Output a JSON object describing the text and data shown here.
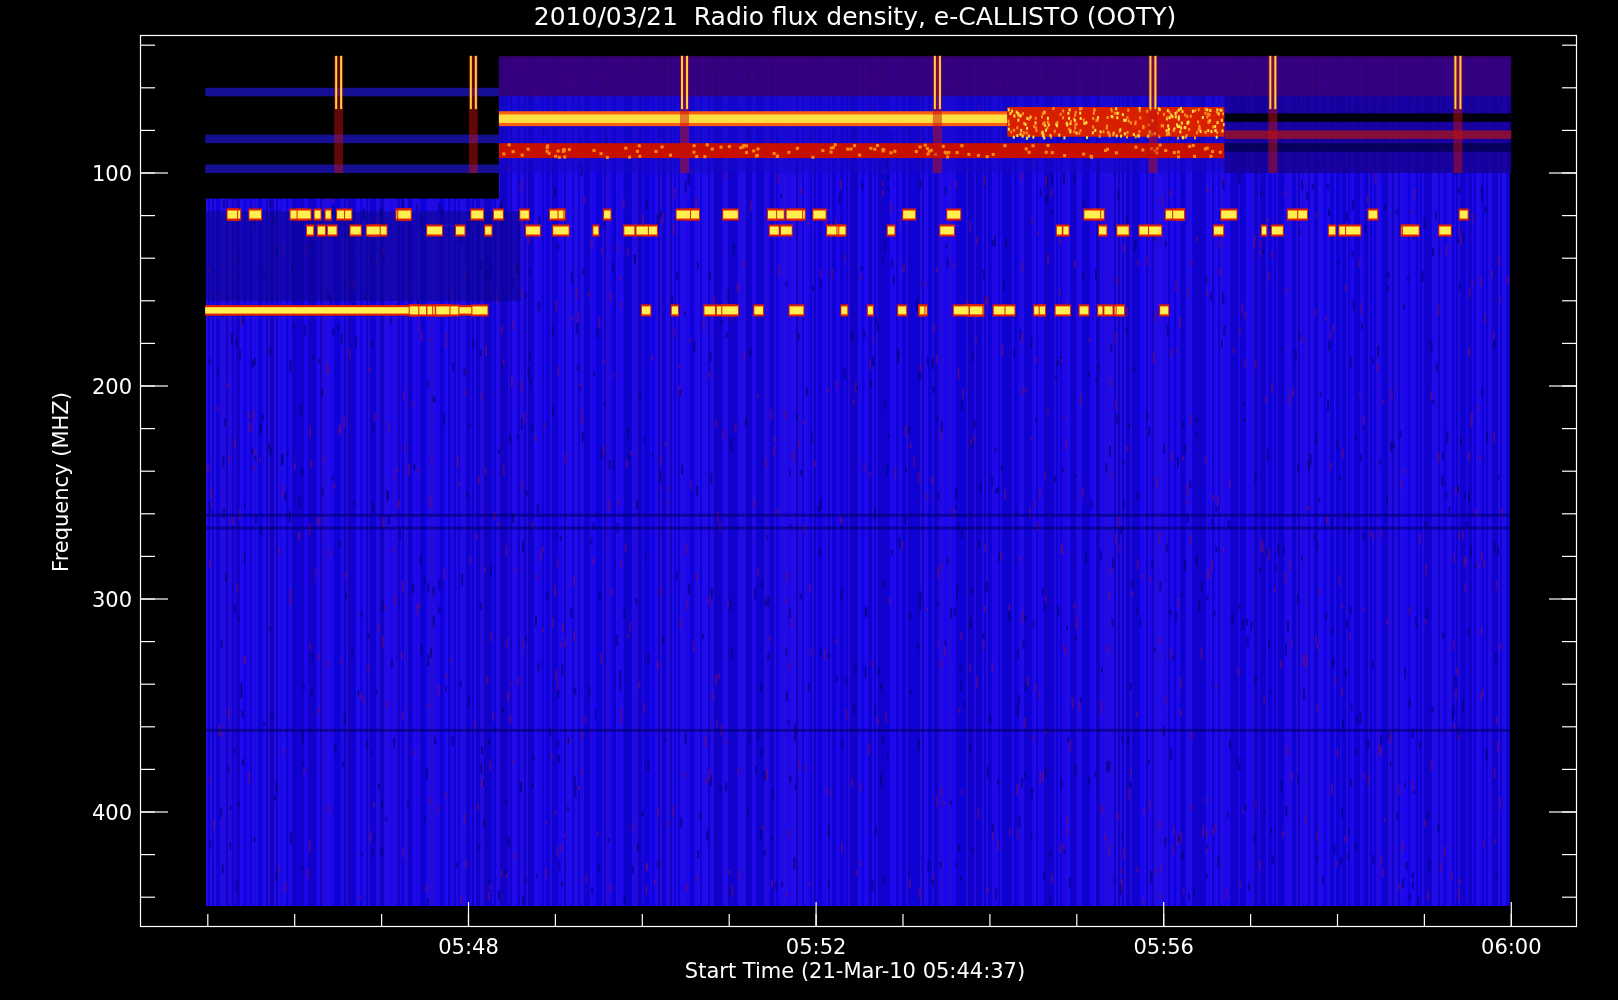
{
  "title": "2010/03/21  Radio flux density, e-CALLISTO (OOTY)",
  "ylabel": "Frequency (MHZ)",
  "xlabel": "Start Time (21-Mar-10 05:44:37)",
  "yticks": [
    "100",
    "200",
    "300",
    "400"
  ],
  "xticks": [
    "05:48",
    "05:52",
    "05:56",
    "06:00"
  ]
}
